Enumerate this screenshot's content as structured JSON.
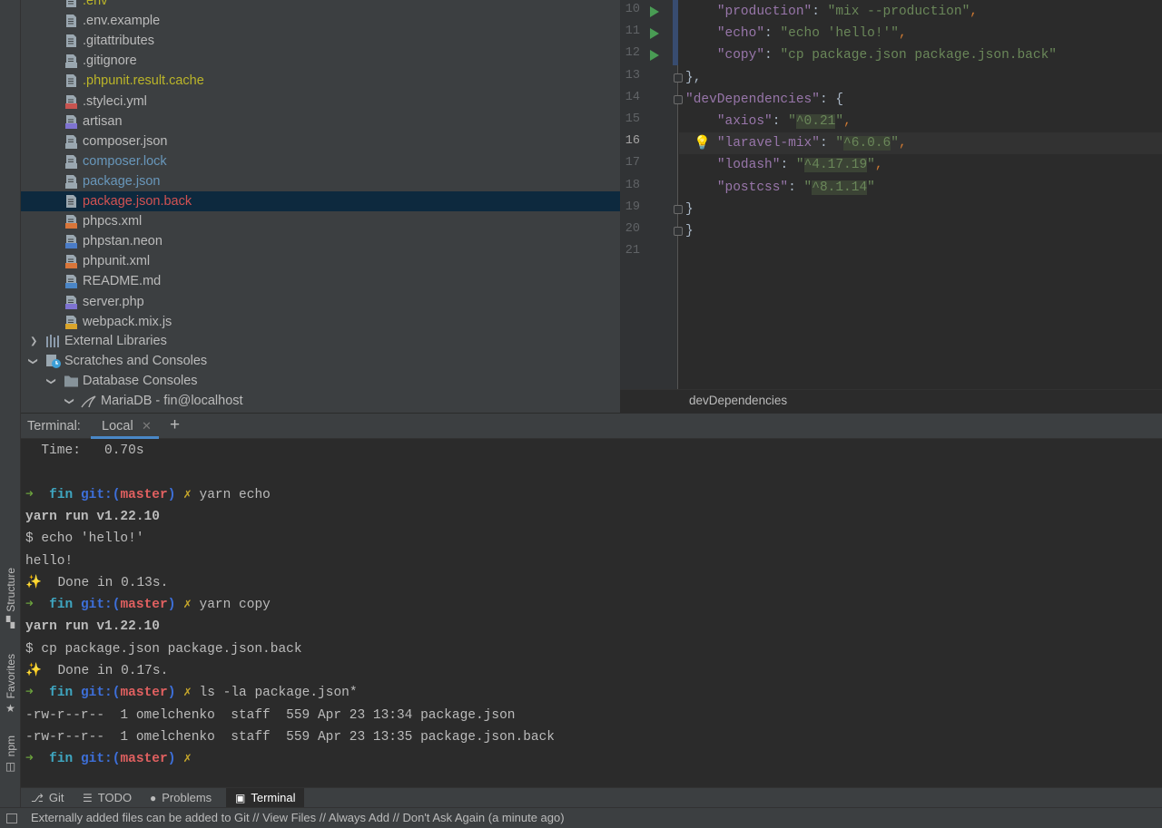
{
  "left_strip": {
    "structure": "Structure",
    "favorites": "Favorites",
    "npm": "npm"
  },
  "project": {
    "items": [
      {
        "name": ".env",
        "color": "#bbb529",
        "icon": "file-icon"
      },
      {
        "name": ".env.example",
        "color": "#bbbbbb",
        "icon": "file-icon"
      },
      {
        "name": ".gitattributes",
        "color": "#bbbbbb",
        "icon": "file-icon"
      },
      {
        "name": ".gitignore",
        "color": "#bbbbbb",
        "icon": "gitignore-file-icon"
      },
      {
        "name": ".phpunit.result.cache",
        "color": "#bbb529",
        "icon": "file-icon"
      },
      {
        "name": ".styleci.yml",
        "color": "#bbbbbb",
        "icon": "yml-file-icon"
      },
      {
        "name": "artisan",
        "color": "#bbbbbb",
        "icon": "php-file-icon"
      },
      {
        "name": "composer.json",
        "color": "#bbbbbb",
        "icon": "composer-json-icon"
      },
      {
        "name": "composer.lock",
        "color": "#6897bb",
        "icon": "composer-lock-icon"
      },
      {
        "name": "package.json",
        "color": "#6897bb",
        "icon": "json-file-icon"
      },
      {
        "name": "package.json.back",
        "color": "#d25252",
        "icon": "file-icon"
      },
      {
        "name": "phpcs.xml",
        "color": "#bbbbbb",
        "icon": "xml-file-icon"
      },
      {
        "name": "phpstan.neon",
        "color": "#bbbbbb",
        "icon": "neon-file-icon"
      },
      {
        "name": "phpunit.xml",
        "color": "#bbbbbb",
        "icon": "xml-file-icon"
      },
      {
        "name": "README.md",
        "color": "#bbbbbb",
        "icon": "md-file-icon"
      },
      {
        "name": "server.php",
        "color": "#bbbbbb",
        "icon": "php-file-icon"
      },
      {
        "name": "webpack.mix.js",
        "color": "#bbbbbb",
        "icon": "js-file-icon"
      }
    ],
    "external_libraries": "External Libraries",
    "scratches": "Scratches and Consoles",
    "database_consoles": "Database Consoles",
    "mariadb": "MariaDB - fin@localhost"
  },
  "editor": {
    "line_numbers": [
      "10",
      "11",
      "12",
      "13",
      "14",
      "15",
      "16",
      "17",
      "18",
      "19",
      "20",
      "21"
    ],
    "current_line": "16",
    "breadcrumb": "devDependencies",
    "lines": [
      {
        "indent": "    ",
        "key": "\"production\"",
        "sep": ": ",
        "val": "\"mix --production\"",
        "end": ","
      },
      {
        "indent": "    ",
        "key": "\"echo\"",
        "sep": ": ",
        "val": "\"echo 'hello!'\"",
        "end": ","
      },
      {
        "indent": "    ",
        "key": "\"copy\"",
        "sep": ": ",
        "val": "\"cp package.json package.json.back\"",
        "end": ""
      },
      {
        "indent": "",
        "text": "},"
      },
      {
        "indent": "",
        "key": "\"devDependencies\"",
        "sep": ": ",
        "text2": "{"
      },
      {
        "indent": "    ",
        "key": "\"axios\"",
        "sep": ": ",
        "q1": "\"",
        "ver": "^0.21",
        "q2": "\"",
        "end": ","
      },
      {
        "indent": "    ",
        "key": "\"laravel-mix\"",
        "sep": ": ",
        "q1": "\"",
        "ver": "^6.0.6",
        "q2": "\"",
        "end": ","
      },
      {
        "indent": "    ",
        "key": "\"lodash\"",
        "sep": ": ",
        "q1": "\"",
        "ver": "^4.17.19",
        "q2": "\"",
        "end": ","
      },
      {
        "indent": "    ",
        "key": "\"postcss\"",
        "sep": ": ",
        "q1": "\"",
        "ver": "^8.1.14",
        "q2": "\"",
        "end": ""
      },
      {
        "indent": "",
        "text": "}"
      },
      {
        "indent": "",
        "text": "}"
      },
      {
        "indent": "",
        "text": ""
      }
    ]
  },
  "terminal": {
    "label": "Terminal:",
    "tab": "Local",
    "lines": [
      {
        "type": "plain",
        "text": "  Time:   0.70s"
      },
      {
        "type": "plain",
        "text": ""
      },
      {
        "type": "prompt",
        "cmd": "yarn echo"
      },
      {
        "type": "bold",
        "text": "yarn run v1.22.10"
      },
      {
        "type": "plain",
        "text": "$ echo 'hello!'"
      },
      {
        "type": "plain",
        "text": "hello!"
      },
      {
        "type": "plain",
        "text": "✨  Done in 0.13s."
      },
      {
        "type": "prompt",
        "cmd": "yarn copy"
      },
      {
        "type": "bold",
        "text": "yarn run v1.22.10"
      },
      {
        "type": "plain",
        "text": "$ cp package.json package.json.back"
      },
      {
        "type": "plain",
        "text": "✨  Done in 0.17s."
      },
      {
        "type": "prompt",
        "cmd": "ls -la package.json*"
      },
      {
        "type": "plain",
        "text": "-rw-r--r--  1 omelchenko  staff  559 Apr 23 13:34 package.json"
      },
      {
        "type": "plain",
        "text": "-rw-r--r--  1 omelchenko  staff  559 Apr 23 13:35 package.json.back"
      },
      {
        "type": "prompt",
        "cmd": ""
      }
    ],
    "prompt_arrow": "➜",
    "prompt_dir": "fin",
    "prompt_git": "git:(",
    "prompt_branch": "master",
    "prompt_close": ")",
    "prompt_x": "✗"
  },
  "bottom_tabs": {
    "git": "Git",
    "todo": "TODO",
    "problems": "Problems",
    "terminal": "Terminal"
  },
  "status_bar": {
    "message": "Externally added files can be added to Git // View Files // Always Add // Don't Ask Again (a minute ago)"
  }
}
